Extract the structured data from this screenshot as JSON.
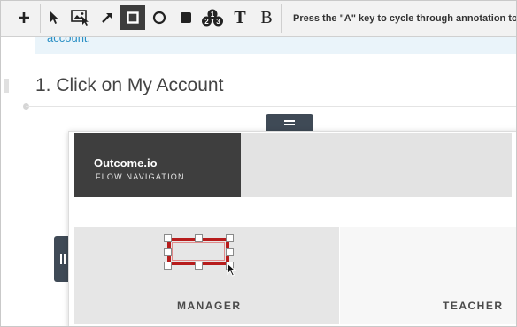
{
  "toolbar": {
    "hint": "Press the \"A\" key to cycle through annotation tools. Us",
    "tools": [
      {
        "name": "add-icon",
        "glyph": "+"
      },
      {
        "name": "pointer-icon",
        "glyph": "arrow"
      },
      {
        "name": "image-select-icon",
        "glyph": "image"
      },
      {
        "name": "arrow-tool-icon",
        "glyph": "diagonal-arrow"
      },
      {
        "name": "rectangle-tool-icon",
        "glyph": "square",
        "active": true
      },
      {
        "name": "circle-tool-icon",
        "glyph": "circle"
      },
      {
        "name": "filled-rectangle-tool-icon",
        "glyph": "filled-square"
      },
      {
        "name": "step-numbers-tool-icon",
        "glyph": "123"
      },
      {
        "name": "text-tool-icon",
        "glyph": "T"
      },
      {
        "name": "bold-text-tool-icon",
        "glyph": "B"
      }
    ]
  },
  "document": {
    "banner_link": "account.",
    "step_title": "1. Click on My Account"
  },
  "app": {
    "logo_name": "Outcome.io",
    "logo_sub": "FLOW NAVIGATION",
    "roles": [
      "MANAGER",
      "TEACHER"
    ]
  },
  "colors": {
    "annotation": "#b71c1c",
    "toolbar_active": "#3c3c3c",
    "handle": "#3f4a56",
    "link": "#2a8fc4"
  }
}
